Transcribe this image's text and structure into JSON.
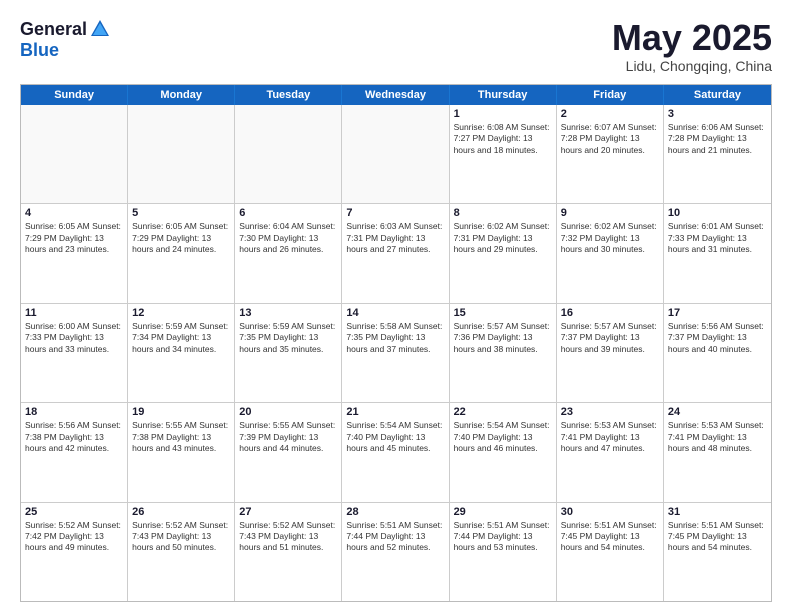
{
  "logo": {
    "general": "General",
    "blue": "Blue"
  },
  "title": "May 2025",
  "location": "Lidu, Chongqing, China",
  "days_of_week": [
    "Sunday",
    "Monday",
    "Tuesday",
    "Wednesday",
    "Thursday",
    "Friday",
    "Saturday"
  ],
  "weeks": [
    [
      {
        "day": "",
        "info": ""
      },
      {
        "day": "",
        "info": ""
      },
      {
        "day": "",
        "info": ""
      },
      {
        "day": "",
        "info": ""
      },
      {
        "day": "1",
        "info": "Sunrise: 6:08 AM\nSunset: 7:27 PM\nDaylight: 13 hours\nand 18 minutes."
      },
      {
        "day": "2",
        "info": "Sunrise: 6:07 AM\nSunset: 7:28 PM\nDaylight: 13 hours\nand 20 minutes."
      },
      {
        "day": "3",
        "info": "Sunrise: 6:06 AM\nSunset: 7:28 PM\nDaylight: 13 hours\nand 21 minutes."
      }
    ],
    [
      {
        "day": "4",
        "info": "Sunrise: 6:05 AM\nSunset: 7:29 PM\nDaylight: 13 hours\nand 23 minutes."
      },
      {
        "day": "5",
        "info": "Sunrise: 6:05 AM\nSunset: 7:29 PM\nDaylight: 13 hours\nand 24 minutes."
      },
      {
        "day": "6",
        "info": "Sunrise: 6:04 AM\nSunset: 7:30 PM\nDaylight: 13 hours\nand 26 minutes."
      },
      {
        "day": "7",
        "info": "Sunrise: 6:03 AM\nSunset: 7:31 PM\nDaylight: 13 hours\nand 27 minutes."
      },
      {
        "day": "8",
        "info": "Sunrise: 6:02 AM\nSunset: 7:31 PM\nDaylight: 13 hours\nand 29 minutes."
      },
      {
        "day": "9",
        "info": "Sunrise: 6:02 AM\nSunset: 7:32 PM\nDaylight: 13 hours\nand 30 minutes."
      },
      {
        "day": "10",
        "info": "Sunrise: 6:01 AM\nSunset: 7:33 PM\nDaylight: 13 hours\nand 31 minutes."
      }
    ],
    [
      {
        "day": "11",
        "info": "Sunrise: 6:00 AM\nSunset: 7:33 PM\nDaylight: 13 hours\nand 33 minutes."
      },
      {
        "day": "12",
        "info": "Sunrise: 5:59 AM\nSunset: 7:34 PM\nDaylight: 13 hours\nand 34 minutes."
      },
      {
        "day": "13",
        "info": "Sunrise: 5:59 AM\nSunset: 7:35 PM\nDaylight: 13 hours\nand 35 minutes."
      },
      {
        "day": "14",
        "info": "Sunrise: 5:58 AM\nSunset: 7:35 PM\nDaylight: 13 hours\nand 37 minutes."
      },
      {
        "day": "15",
        "info": "Sunrise: 5:57 AM\nSunset: 7:36 PM\nDaylight: 13 hours\nand 38 minutes."
      },
      {
        "day": "16",
        "info": "Sunrise: 5:57 AM\nSunset: 7:37 PM\nDaylight: 13 hours\nand 39 minutes."
      },
      {
        "day": "17",
        "info": "Sunrise: 5:56 AM\nSunset: 7:37 PM\nDaylight: 13 hours\nand 40 minutes."
      }
    ],
    [
      {
        "day": "18",
        "info": "Sunrise: 5:56 AM\nSunset: 7:38 PM\nDaylight: 13 hours\nand 42 minutes."
      },
      {
        "day": "19",
        "info": "Sunrise: 5:55 AM\nSunset: 7:38 PM\nDaylight: 13 hours\nand 43 minutes."
      },
      {
        "day": "20",
        "info": "Sunrise: 5:55 AM\nSunset: 7:39 PM\nDaylight: 13 hours\nand 44 minutes."
      },
      {
        "day": "21",
        "info": "Sunrise: 5:54 AM\nSunset: 7:40 PM\nDaylight: 13 hours\nand 45 minutes."
      },
      {
        "day": "22",
        "info": "Sunrise: 5:54 AM\nSunset: 7:40 PM\nDaylight: 13 hours\nand 46 minutes."
      },
      {
        "day": "23",
        "info": "Sunrise: 5:53 AM\nSunset: 7:41 PM\nDaylight: 13 hours\nand 47 minutes."
      },
      {
        "day": "24",
        "info": "Sunrise: 5:53 AM\nSunset: 7:41 PM\nDaylight: 13 hours\nand 48 minutes."
      }
    ],
    [
      {
        "day": "25",
        "info": "Sunrise: 5:52 AM\nSunset: 7:42 PM\nDaylight: 13 hours\nand 49 minutes."
      },
      {
        "day": "26",
        "info": "Sunrise: 5:52 AM\nSunset: 7:43 PM\nDaylight: 13 hours\nand 50 minutes."
      },
      {
        "day": "27",
        "info": "Sunrise: 5:52 AM\nSunset: 7:43 PM\nDaylight: 13 hours\nand 51 minutes."
      },
      {
        "day": "28",
        "info": "Sunrise: 5:51 AM\nSunset: 7:44 PM\nDaylight: 13 hours\nand 52 minutes."
      },
      {
        "day": "29",
        "info": "Sunrise: 5:51 AM\nSunset: 7:44 PM\nDaylight: 13 hours\nand 53 minutes."
      },
      {
        "day": "30",
        "info": "Sunrise: 5:51 AM\nSunset: 7:45 PM\nDaylight: 13 hours\nand 54 minutes."
      },
      {
        "day": "31",
        "info": "Sunrise: 5:51 AM\nSunset: 7:45 PM\nDaylight: 13 hours\nand 54 minutes."
      }
    ]
  ]
}
